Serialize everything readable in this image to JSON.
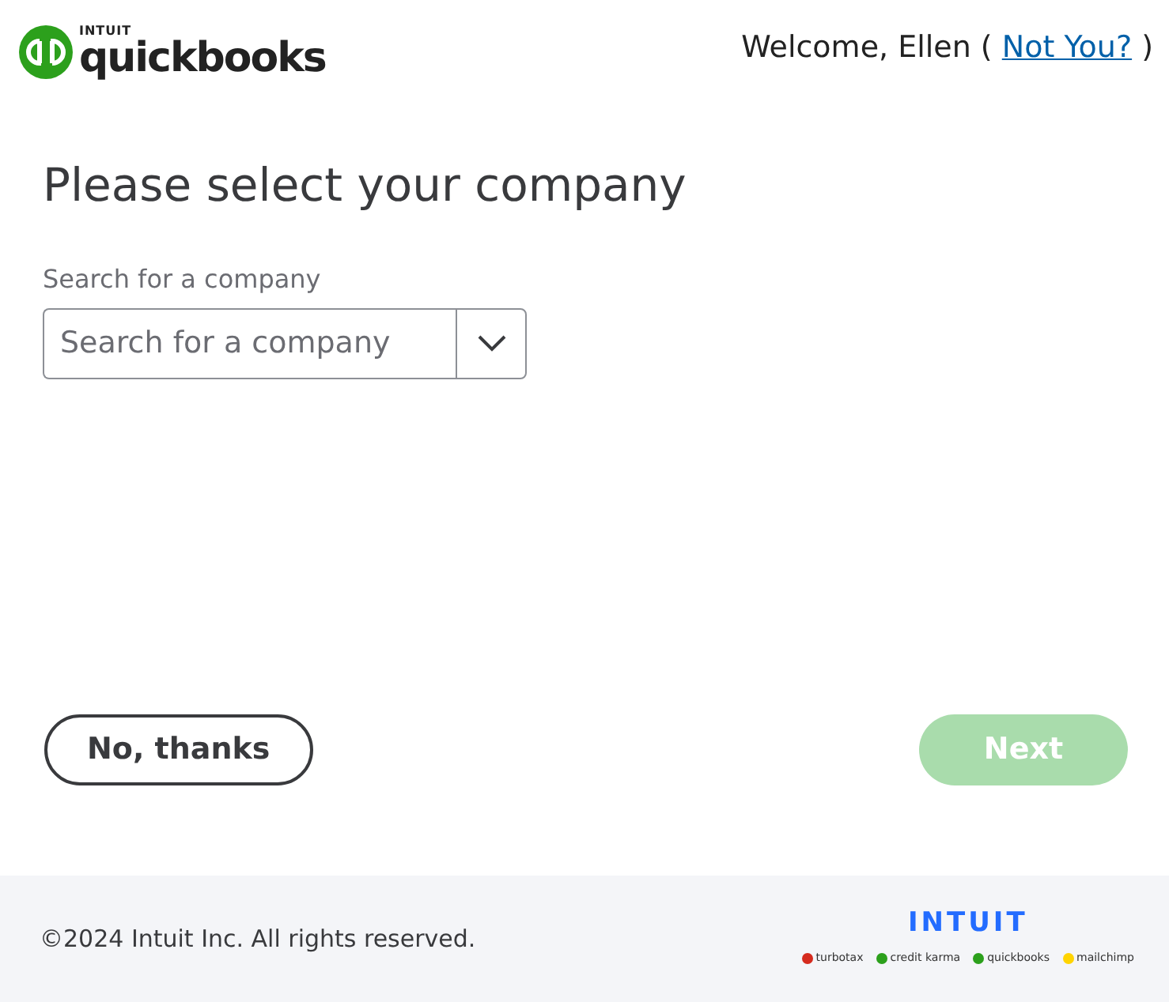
{
  "header": {
    "logo": {
      "brand": "INTUIT",
      "product": "quickbooks"
    },
    "welcome": {
      "before": "Welcome, Ellen (",
      "link": "Not You?",
      "after": ")"
    }
  },
  "title": "Please select your company",
  "search": {
    "label": "Search for a company",
    "placeholder": "Search for a company"
  },
  "buttons": [
    {
      "label": "No, thanks",
      "kind": "secondary",
      "disabled": false
    },
    {
      "label": "Next",
      "kind": "primary",
      "disabled": true
    }
  ],
  "footer": {
    "copyright": "©2024 Intuit Inc. All rights reserved.",
    "brand": "INTUIT",
    "products": [
      {
        "name": "turbotax",
        "color": "#d52b1e"
      },
      {
        "name": "credit karma",
        "color": "#2ca01c"
      },
      {
        "name": "quickbooks",
        "color": "#2ca01c"
      },
      {
        "name": "mailchimp",
        "color": "#ffd400"
      }
    ]
  }
}
